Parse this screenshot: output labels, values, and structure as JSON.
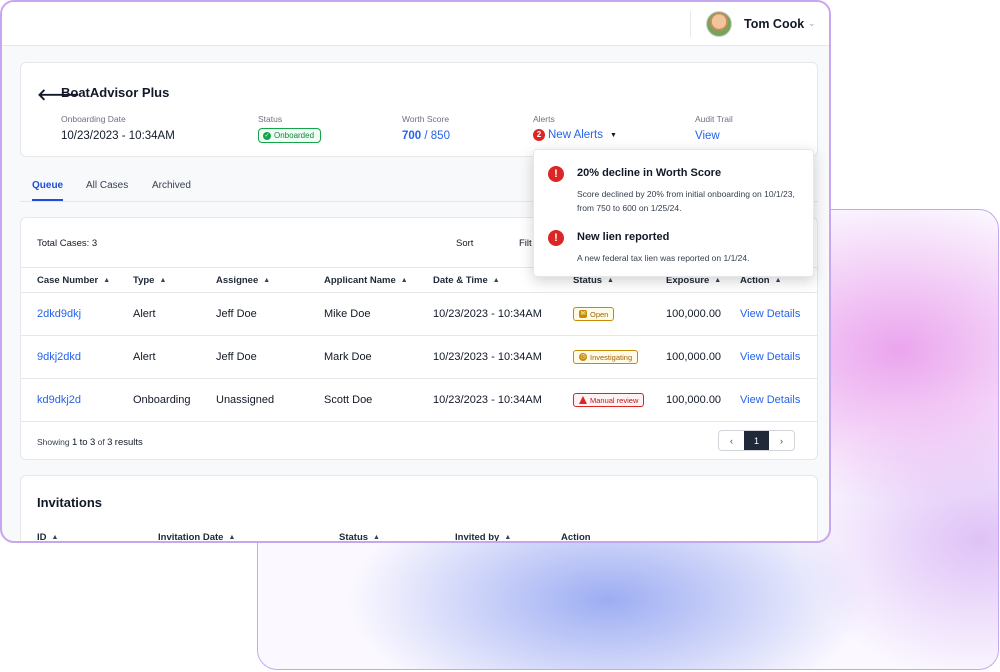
{
  "user": {
    "name": "Tom Cook"
  },
  "company": {
    "name": "BoatAdvisor Plus",
    "onboarding_label": "Onboarding Date",
    "onboarding_value": "10/23/2023 - 10:34AM",
    "status_label": "Status",
    "status_value": "Onboarded",
    "worth_label": "Worth Score",
    "worth_score": "700",
    "worth_max": "/ 850",
    "alerts_label": "Alerts",
    "alerts_count": "2",
    "alerts_link": "New Alerts",
    "audit_label": "Audit Trail",
    "audit_link": "View"
  },
  "tabs": [
    {
      "label": "Queue",
      "active": true
    },
    {
      "label": "All Cases",
      "active": false
    },
    {
      "label": "Archived",
      "active": false
    }
  ],
  "cases": {
    "total": "Total Cases: 3",
    "sort": "Sort",
    "filter": "Filt",
    "columns": [
      "Case Number",
      "Type",
      "Assignee",
      "Applicant Name",
      "Date & Time",
      "Status",
      "Exposure",
      "Action"
    ],
    "rows": [
      {
        "case": "2dkd9dkj",
        "type": "Alert",
        "assignee": "Jeff Doe",
        "applicant": "Mike Doe",
        "datetime": "10/23/2023 - 10:34AM",
        "status": "Open",
        "exposure": "100,000.00",
        "action": "View Details"
      },
      {
        "case": "9dkj2dkd",
        "type": "Alert",
        "assignee": "Jeff Doe",
        "applicant": "Mark Doe",
        "datetime": "10/23/2023 - 10:34AM",
        "status": "Investigating",
        "exposure": "100,000.00",
        "action": "View Details"
      },
      {
        "case": "kd9dkj2d",
        "type": "Onboarding",
        "assignee": "Unassigned",
        "applicant": "Scott Doe",
        "datetime": "10/23/2023 - 10:34AM",
        "status": "Manual review",
        "exposure": "100,000.00",
        "action": "View Details"
      }
    ],
    "results": {
      "prefix": "Showing",
      "from": "1",
      "to_word": "to",
      "to": "3",
      "of_word": "of",
      "total": "3",
      "suffix": "results"
    },
    "pager": {
      "prev": "‹",
      "current": "1",
      "next": "›"
    }
  },
  "invitations": {
    "title": "Invitations",
    "columns": [
      "ID",
      "Invitation Date",
      "Status",
      "Invited by",
      "Action"
    ]
  },
  "alerts_popup": [
    {
      "title": "20% decline in Worth Score",
      "desc": "Score declined by 20% from initial onboarding on 10/1/23, from 750 to 600 on 1/25/24."
    },
    {
      "title": "New lien reported",
      "desc": "A new federal tax lien was reported on 1/1/24."
    }
  ]
}
